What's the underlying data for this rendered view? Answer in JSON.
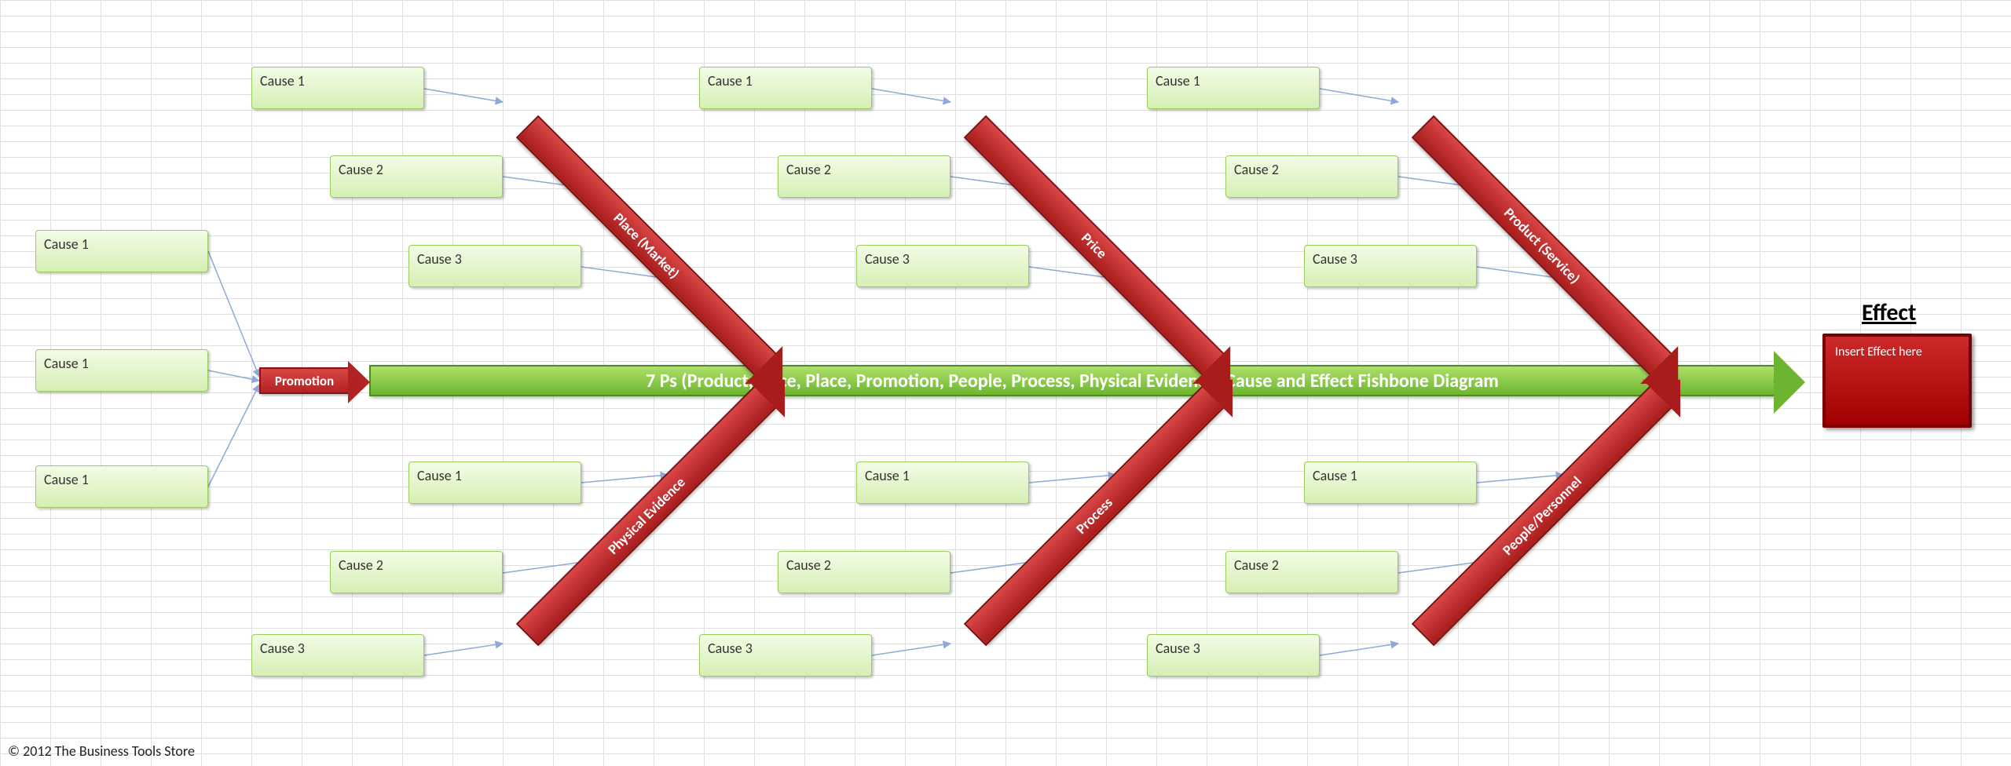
{
  "spine_title": "7 Ps (Product, Price, Place, Promotion, People, Process, Physical Evidence) Cause and Effect Fishbone Diagram",
  "effect_label": "Effect",
  "effect_box": "Insert Effect here",
  "promotion_label": "Promotion",
  "copyright": "© 2012 The Business Tools Store",
  "bones_top": [
    {
      "label": "Place (Market)",
      "causes": [
        "Cause 1",
        "Cause 2",
        "Cause 3"
      ]
    },
    {
      "label": "Price",
      "causes": [
        "Cause 1",
        "Cause 2",
        "Cause 3"
      ]
    },
    {
      "label": "Product (Service)",
      "causes": [
        "Cause 1",
        "Cause 2",
        "Cause 3"
      ]
    }
  ],
  "bones_bottom": [
    {
      "label": "Physical Evidence",
      "causes": [
        "Cause 1",
        "Cause 2",
        "Cause 3"
      ]
    },
    {
      "label": "Process",
      "causes": [
        "Cause 1",
        "Cause 2",
        "Cause 3"
      ]
    },
    {
      "label": "People/Personnel",
      "causes": [
        "Cause 1",
        "Cause 2",
        "Cause 3"
      ]
    }
  ],
  "promo_causes": [
    "Cause 1",
    "Cause 1",
    "Cause 1"
  ]
}
